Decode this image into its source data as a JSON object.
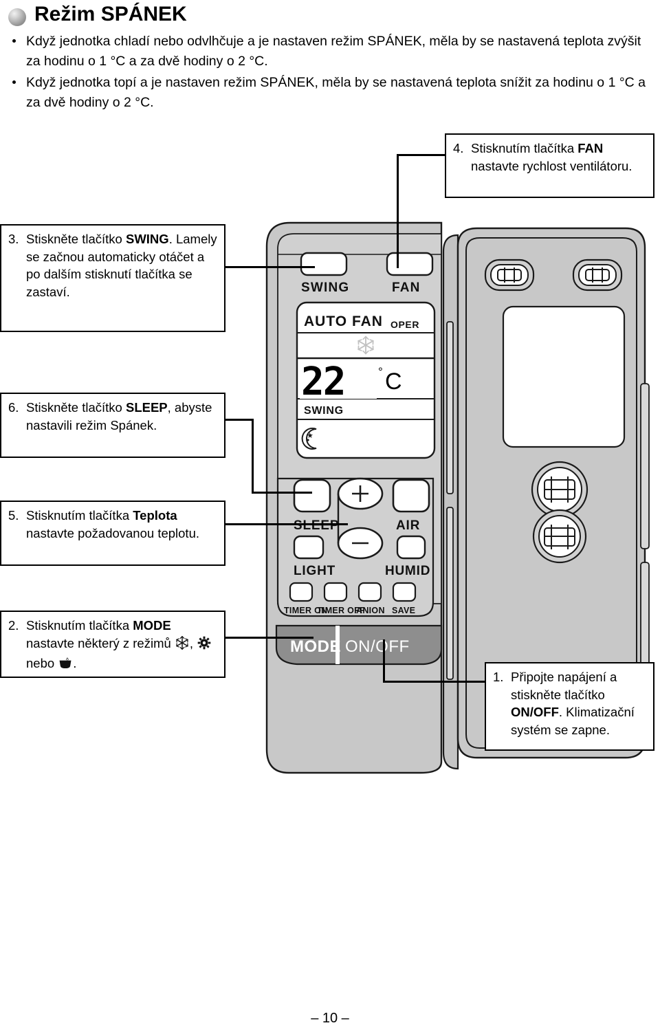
{
  "header": {
    "bullet_icon": "sphere-bullet-icon",
    "title": "Režim SPÁNEK"
  },
  "intro": {
    "items": [
      "Když jednotka chladí nebo odvlhčuje a je nastaven režim SPÁNEK, měla by se nastavená teplota zvýšit za hodinu o 1 °C a za dvě hodiny o 2 °C.",
      "Když jednotka topí a je nastaven režim SPÁNEK, měla by se nastavená teplota snížit za hodinu o 1 °C a za dvě hodiny o 2 °C."
    ]
  },
  "callouts": [
    {
      "id": "callout-1",
      "number": "1.",
      "text_parts": [
        {
          "text": "Připojte napájení a stiskněte tlačítko ",
          "bold": false
        },
        {
          "text": "ON/OFF",
          "bold": true
        },
        {
          "text": ". Klimatizační systém se zapne.",
          "bold": false
        }
      ]
    },
    {
      "id": "callout-2",
      "number": "2.",
      "text_parts": [
        {
          "text": "Stisknutím tlačítka ",
          "bold": false
        },
        {
          "text": "MODE",
          "bold": true
        },
        {
          "text": " nastavte některý z režimů ",
          "bold": false
        }
      ],
      "trailing_icons": [
        "snowflake-icon",
        "sun-icon",
        "dry-icon"
      ],
      "icon_separator": ",",
      "icon_conjunction": "nebo",
      "trailing_period": "."
    },
    {
      "id": "callout-3",
      "number": "3.",
      "text_parts": [
        {
          "text": "Stiskněte tlačítko ",
          "bold": false
        },
        {
          "text": "SWING",
          "bold": true
        },
        {
          "text": ". Lamely se začnou automaticky otáčet a po dalším stisknutí tlačítka se zastaví.",
          "bold": false
        }
      ]
    },
    {
      "id": "callout-4",
      "number": "4.",
      "text_parts": [
        {
          "text": "Stisknutím tlačítka ",
          "bold": false
        },
        {
          "text": "FAN",
          "bold": true
        },
        {
          "text": " nastavte rychlost ventilátoru.",
          "bold": false
        }
      ]
    },
    {
      "id": "callout-5",
      "number": "5.",
      "text_parts": [
        {
          "text": "Stisknutím tlačítka ",
          "bold": false
        },
        {
          "text": "Teplota",
          "bold": true
        },
        {
          "text": " nastavte požadovanou teplotu.",
          "bold": false
        }
      ]
    },
    {
      "id": "callout-6",
      "number": "6.",
      "text_parts": [
        {
          "text": "Stiskněte tlačítko ",
          "bold": false
        },
        {
          "text": "SLEEP",
          "bold": true
        },
        {
          "text": ", abyste nastavili režim Spánek.",
          "bold": false
        }
      ]
    }
  ],
  "remote": {
    "top_buttons": [
      {
        "label": "SWING",
        "name": "swing-button"
      },
      {
        "label": "FAN",
        "name": "fan-button"
      }
    ],
    "lcd": {
      "fan_mode": "AUTO FAN",
      "oper": "OPER",
      "mode_icon": "snowflake-icon",
      "temperature": "22",
      "degree": "°",
      "unit": "C",
      "swing": "SWING",
      "sleep_icon": "moon-icon"
    },
    "mid_buttons": [
      {
        "label": "SLEEP",
        "name": "sleep-button"
      },
      {
        "label": "LIGHT",
        "name": "light-button"
      },
      {
        "label": "AIR",
        "name": "air-button"
      },
      {
        "label": "HUMID",
        "name": "humid-button"
      }
    ],
    "temp_buttons": [
      {
        "label": "+",
        "name": "temp-up-button"
      },
      {
        "label": "−",
        "name": "temp-down-button"
      }
    ],
    "bottom_row_buttons": [
      {
        "label": "TIMER ON",
        "name": "timer-on-button"
      },
      {
        "label": "TIMER OFF",
        "name": "timer-off-button"
      },
      {
        "label": "ANION",
        "name": "anion-button"
      },
      {
        "label": "SAVE",
        "name": "save-button"
      }
    ],
    "bar_buttons": [
      {
        "label": "MODE",
        "name": "mode-button"
      },
      {
        "label": "ON/OFF",
        "name": "onoff-button"
      }
    ]
  },
  "footer": {
    "page_number": "– 10 –"
  },
  "colors": {
    "body_fill": "#c8c8c8",
    "body_fill_light": "#d2d2d2",
    "bar_fill": "#909090",
    "outline": "#1a1a1a",
    "button_fill": "#ffffff",
    "lcd_fill": "#ffffff",
    "snowflake_gray": "#c0c0c0"
  }
}
